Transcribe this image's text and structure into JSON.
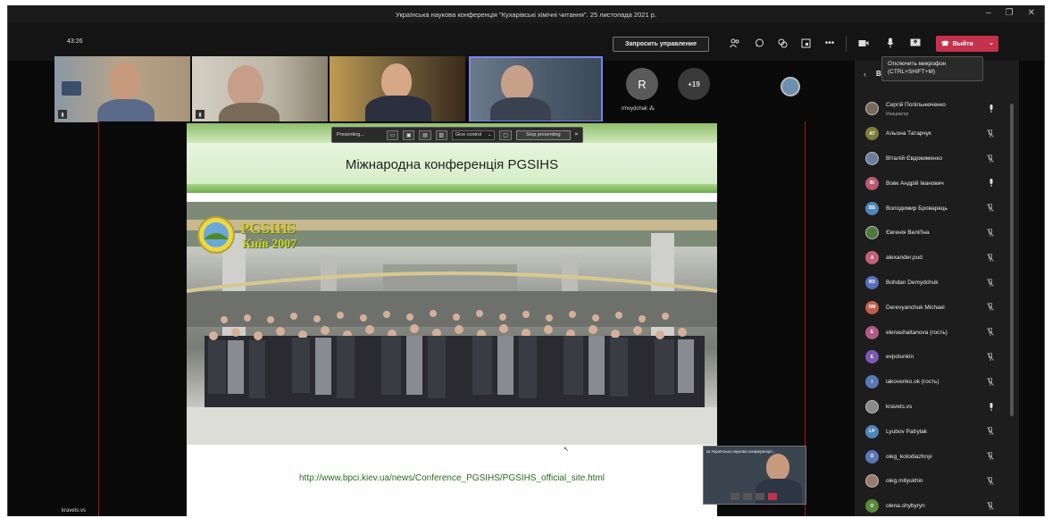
{
  "window": {
    "title": "Українська наукова конференція \"Кухарівські хімічні читання\". 25 листопада 2021 р."
  },
  "toolbar": {
    "timer": "43:26",
    "request_control": "Запросить управление",
    "leave_label": "Выйти",
    "tooltip_line1": "Отключить микрофон",
    "tooltip_line2": "(CTRL+SHIFT+M)"
  },
  "strip": {
    "avatar_letter": "R",
    "avatar_name": "rmvydchak",
    "overflow": "+19"
  },
  "presenter_bar": {
    "presenting": "Presenting...",
    "give_control": "Give control",
    "stop": "Stop presenting"
  },
  "slide": {
    "title": "Міжнародна конференція PGSIHS",
    "logo_line1": "PGSIHS",
    "logo_line2": "Київ 2007",
    "url": "http://www.bpci.kiev.ua/news/Conference_PGSIHS/PGSIHS_official_site.html"
  },
  "pip": {
    "title": "Ш Українська наукова конференція..."
  },
  "current_user": "kravets.vs",
  "panel": {
    "back_letter": "В",
    "participants": [
      {
        "initials": "",
        "name": "Сергій Попільнюченко",
        "role": "Инициатор",
        "color": "#7a6a5a",
        "mic": "on",
        "photo": true
      },
      {
        "initials": "АТ",
        "name": "Альона Татарчук",
        "color": "#7b7f3a",
        "mic": "off"
      },
      {
        "initials": "",
        "name": "Віталій Євдокименко",
        "color": "#6a7fa0",
        "mic": "off",
        "photo": true
      },
      {
        "initials": "ВІ",
        "name": "Вовк Андрій Іванович",
        "color": "#b85a72",
        "mic": "on"
      },
      {
        "initials": "ВБ",
        "name": "Володимир Броварець",
        "color": "#4f86b8",
        "mic": "off"
      },
      {
        "initials": "",
        "name": "Євгенія Веліґіна",
        "color": "#4c7a3a",
        "mic": "off",
        "photo": true
      },
      {
        "initials": "А",
        "name": "alexander.pud",
        "color": "#c0607a",
        "mic": "off"
      },
      {
        "initials": "BD",
        "name": "Bohdan Demydchuk",
        "color": "#5570b8",
        "mic": "off"
      },
      {
        "initials": "DM",
        "name": "Derevyanchuk Michael",
        "color": "#c0604a",
        "mic": "off"
      },
      {
        "initials": "E",
        "name": "elenashaitanova (гость)",
        "color": "#b05a86",
        "mic": "off"
      },
      {
        "initials": "E",
        "name": "evpolunkin",
        "color": "#7a5ab0",
        "mic": "off"
      },
      {
        "initials": "I",
        "name": "iakovenko.ok (гость)",
        "color": "#5a78b8",
        "mic": "off"
      },
      {
        "initials": "",
        "name": "kravets.vs",
        "color": "#8a8a8a",
        "mic": "on",
        "photo": true
      },
      {
        "initials": "LP",
        "name": "Lyubov Patrylak",
        "color": "#4f86b8",
        "mic": "off"
      },
      {
        "initials": "O",
        "name": "oleg_kolodiazhnyi",
        "color": "#5a78b8",
        "mic": "off"
      },
      {
        "initials": "",
        "name": "oleg.mityukhin",
        "color": "#9a7a6a",
        "mic": "off",
        "photo": true
      },
      {
        "initials": "O",
        "name": "olena.shybyryn",
        "color": "#5a8a3a",
        "mic": "off"
      }
    ]
  },
  "colors": {
    "leave": "#c4314b",
    "stage_border": "#9b1b20",
    "url_green": "#2a6a1f"
  }
}
